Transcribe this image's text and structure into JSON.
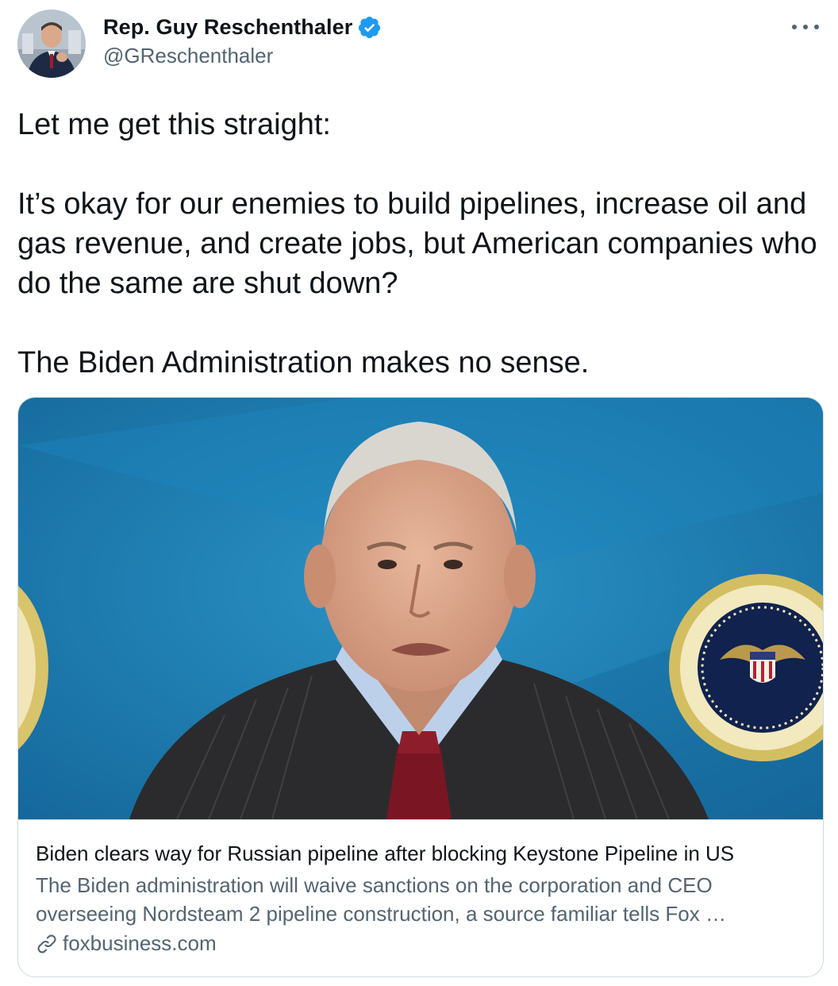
{
  "author": {
    "display_name": "Rep. Guy Reschenthaler",
    "handle": "@GReschenthaler",
    "verified": true,
    "verified_icon": "verified-badge-icon",
    "verified_color": "#1d9bf0"
  },
  "tweet": {
    "paragraphs": [
      "Let me get this straight:",
      "It’s okay for our enemies to build pipelines, increase oil and gas revenue, and create jobs, but American companies who do the same are shut down?",
      "The Biden Administration makes no sense."
    ]
  },
  "card": {
    "title": "Biden clears way for Russian pipeline after blocking Keystone Pipeline in US",
    "description": "The Biden administration will waive sanctions on the corporation and CEO overseeing Nordsteam 2 pipeline construction, a source familiar tells Fox …",
    "domain": "foxbusiness.com",
    "link_icon": "link-icon"
  },
  "colors": {
    "text_primary": "#0f1419",
    "text_secondary": "#536471",
    "border": "#cfd9de",
    "image_background": "#1f7fb4"
  }
}
